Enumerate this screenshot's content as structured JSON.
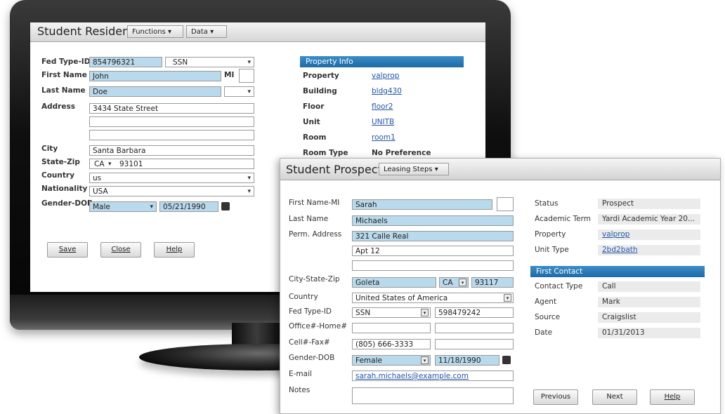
{
  "resident": {
    "title": "Student Resident",
    "menu": {
      "functions": "Functions",
      "data": "Data"
    },
    "labels": {
      "fed_type_id": "Fed Type-ID",
      "first_name": "First Name",
      "mi": "MI",
      "last_name": "Last Name",
      "address": "Address",
      "city": "City",
      "state_zip": "State-Zip",
      "country": "Country",
      "nationality": "Nationality",
      "gender_dob": "Gender-DOB"
    },
    "values": {
      "fed_type_id": "854796321",
      "id_type": "SSN",
      "first_name": "John",
      "last_name": "Doe",
      "address1": "3434 State Street",
      "city": "Santa Barbara",
      "state": "CA",
      "zip": "93101",
      "country": "us",
      "nationality": "USA",
      "gender": "Male",
      "dob": "05/21/1990"
    },
    "buttons": {
      "save": "Save",
      "close": "Close",
      "help": "Help"
    },
    "property_info": {
      "header": "Property Info",
      "labels": {
        "property": "Property",
        "building": "Building",
        "floor": "Floor",
        "unit": "Unit",
        "room": "Room",
        "room_type": "Room Type"
      },
      "values": {
        "property": "valprop",
        "building": "bldg430",
        "floor": "floor2",
        "unit": "UNITB",
        "room": "room1",
        "room_type": "No Preference"
      }
    }
  },
  "prospect": {
    "title": "Student Prospect",
    "leasing_steps": "Leasing Steps",
    "labels": {
      "first_name_mi": "First Name-MI",
      "last_name": "Last Name",
      "perm_address": "Perm. Address",
      "city_state_zip": "City-State-Zip",
      "country": "Country",
      "fed_type_id": "Fed Type-ID",
      "office_home": "Office#-Home#",
      "cell_fax": "Cell#-Fax#",
      "gender_dob": "Gender-DOB",
      "email": "E-mail",
      "notes": "Notes"
    },
    "values": {
      "first_name": "Sarah",
      "last_name": "Michaels",
      "address1": "321 Calle Real",
      "address2": "Apt 12",
      "city": "Goleta",
      "state": "CA",
      "zip": "93117",
      "country": "United States of America",
      "id_type": "SSN",
      "fed_id": "598479242",
      "cell": "(805) 666-3333",
      "gender": "Female",
      "dob": "11/18/1990",
      "email": "sarah.michaels@example.com"
    },
    "status": {
      "labels": {
        "status": "Status",
        "academic_term": "Academic Term",
        "property": "Property",
        "unit_type": "Unit Type"
      },
      "values": {
        "status": "Prospect",
        "academic_term": "Yardi Academic Year 20...",
        "property": "valprop",
        "unit_type": "2bd2bath"
      }
    },
    "first_contact": {
      "header": "First Contact",
      "labels": {
        "contact_type": "Contact Type",
        "agent": "Agent",
        "source": "Source",
        "date": "Date"
      },
      "values": {
        "contact_type": "Call",
        "agent": "Mark",
        "source": "Craigslist",
        "date": "01/31/2013"
      }
    },
    "buttons": {
      "previous": "Previous",
      "next": "Next",
      "help": "Help"
    }
  }
}
